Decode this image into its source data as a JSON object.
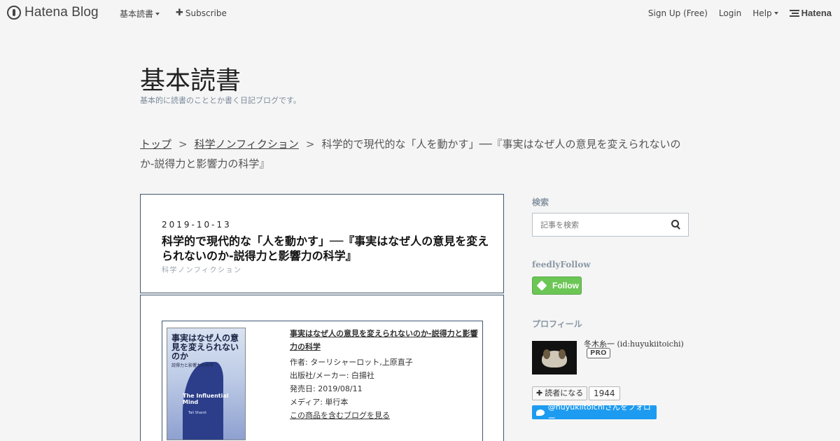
{
  "global": {
    "brand": "Hatena Blog",
    "nav_reading": "基本読書",
    "nav_subscribe": "Subscribe",
    "signup": "Sign Up (Free)",
    "login": "Login",
    "help": "Help",
    "hatena": "Hatena"
  },
  "blog": {
    "title": "基本読書",
    "description": "基本的に読書のこととか書く日記ブログです。"
  },
  "breadcrumb": {
    "top": "トップ",
    "category": "科学ノンフィクション",
    "current": "科学的で現代的な「人を動かす」──『事実はなぜ人の意見を変えられないのか-説得力と影響力の科学』",
    "sep": ">"
  },
  "article": {
    "date": "2019-10-13",
    "title": "科学的で現代的な「人を動かす」──『事実はなぜ人の意見を変えられないのか-説得力と影響力の科学』",
    "category": "科学ノンフィクション"
  },
  "product": {
    "title": "事実はなぜ人の意見を変えられないのか-説得力と影響力の科学",
    "author": "作者: ターリシャーロット,上原直子",
    "publisher": "出版社/メーカー: 白揚社",
    "release": "発売日: 2019/08/11",
    "media": "メディア: 単行本",
    "link": "この商品を含むブログを見る",
    "cover": {
      "title": "事実はなぜ人の意見を変えられないのか",
      "subtitle": "説得力と影響力の科学",
      "en_title": "The Influential Mind",
      "en_author": "Tali Sharot"
    }
  },
  "sidebar": {
    "search_heading": "検索",
    "search_placeholder": "記事を検索",
    "feedly_heading": "feedlyFollow",
    "feedly_button": "Follow",
    "profile_heading": "プロフィール",
    "profile_name": "冬木糸一 (id:huyukiitoichi)",
    "pro_badge": "PRO",
    "reader_button": "読者になる",
    "reader_count": "1944",
    "twitter_button": "@huyukiitoichiさんをフォロー"
  }
}
